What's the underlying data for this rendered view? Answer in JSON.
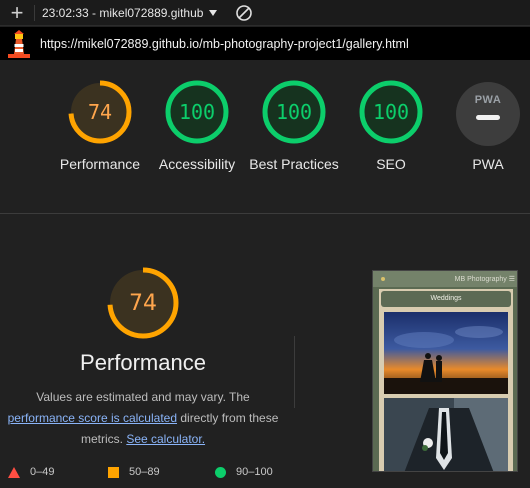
{
  "toolbar": {
    "new_tab_symbol": "+",
    "title": "23:02:33 - mikel072889.github"
  },
  "urlbar": {
    "url": "https://mikel072889.github.io/mb-photography-project1/gallery.html"
  },
  "scores": [
    {
      "label": "Performance",
      "value": "74",
      "level": 0.74,
      "color": "#ffa400"
    },
    {
      "label": "Accessibility",
      "value": "100",
      "level": 1.0,
      "color": "#0cce6b"
    },
    {
      "label": "Best Practices",
      "value": "100",
      "level": 1.0,
      "color": "#0cce6b"
    },
    {
      "label": "SEO",
      "value": "100",
      "level": 1.0,
      "color": "#0cce6b"
    },
    {
      "label": "PWA",
      "badge_text": "PWA"
    }
  ],
  "detail": {
    "score": "74",
    "level": 0.74,
    "title": "Performance",
    "desc_line1": "Values are estimated and may vary. The",
    "link1": "performance score is calculated",
    "desc_mid": " directly from these",
    "desc_line3": "metrics. ",
    "link2": "See calculator."
  },
  "legend": [
    {
      "range": "0–49",
      "color": "#ff4e42",
      "shape": "triangle"
    },
    {
      "range": "50–89",
      "color": "#ffa400",
      "shape": "square"
    },
    {
      "range": "90–100",
      "color": "#0cce6b",
      "shape": "circle"
    }
  ],
  "phone": {
    "brand": "MB Photography ☰",
    "heading": "Weddings"
  }
}
